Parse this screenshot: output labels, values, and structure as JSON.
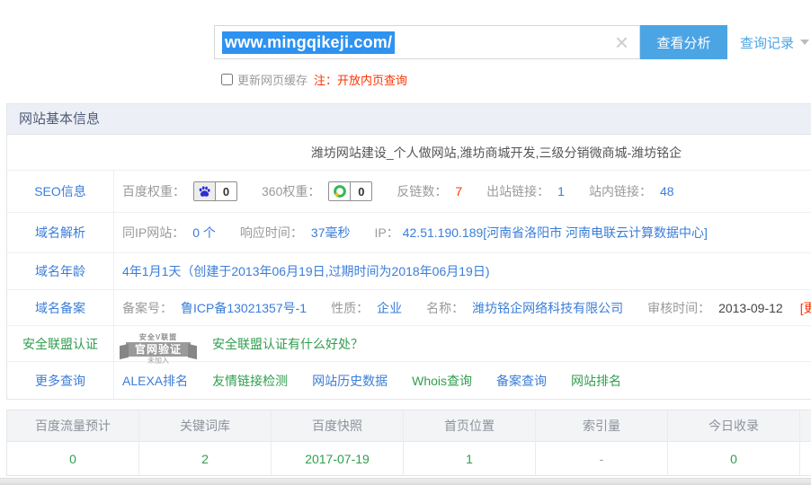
{
  "colors": {
    "link_blue": "#3b7dd8",
    "button_blue": "#4ba4e4",
    "selection_blue": "#2e92f0",
    "green": "#2f9e4e",
    "red": "#ff3300"
  },
  "search": {
    "value": "www.mingqikeji.com/",
    "analyze_button": "查看分析",
    "history_link": "查询记录",
    "cache_checkbox_label": "更新网页缓存",
    "note": "注：开放内页查询"
  },
  "panel": {
    "header": "网站基本信息",
    "site_title": "潍坊网站建设_个人做网站,潍坊商城开发,三级分销微商城-潍坊铭企"
  },
  "seo": {
    "label": "SEO信息",
    "baidu_weight_label": "百度权重：",
    "baidu_weight_value": "0",
    "so360_weight_label": "360权重：",
    "so360_weight_value": "0",
    "backlinks_label": "反链数：",
    "backlinks_value": "7",
    "outlinks_label": "出站链接：",
    "outlinks_value": "1",
    "inlinks_label": "站内链接：",
    "inlinks_value": "48"
  },
  "dns": {
    "label": "域名解析",
    "same_ip_label": "同IP网站：",
    "same_ip_value": "0 个",
    "response_label": "响应时间：",
    "response_value": "37毫秒",
    "ip_label": "IP：",
    "ip_value": "42.51.190.189[河南省洛阳市 河南电联云计算数据中心]"
  },
  "age": {
    "label": "域名年龄",
    "value": "4年1月1天（创建于2013年06月19日,过期时间为2018年06月19日)"
  },
  "icp": {
    "label": "域名备案",
    "number_label": "备案号：",
    "number_value": "鲁ICP备13021357号-1",
    "nature_label": "性质：",
    "nature_value": "企业",
    "name_label": "名称：",
    "name_value": "潍坊铭企网络科技有限公司",
    "audit_label": "审核时间：",
    "audit_value": "2013-09-12",
    "update_link": "[更新]"
  },
  "security": {
    "label": "安全联盟认证",
    "badge_top": "安全V联盟",
    "badge_mid": "官网验证",
    "badge_bottom": "未加入",
    "benefit_link": "安全联盟认证有什么好处？"
  },
  "more": {
    "label": "更多查询",
    "links": [
      {
        "label": "ALEXA排名",
        "color": "blue"
      },
      {
        "label": "友情链接检测",
        "color": "green"
      },
      {
        "label": "网站历史数据",
        "color": "blue"
      },
      {
        "label": "Whois查询",
        "color": "green"
      },
      {
        "label": "备案查询",
        "color": "blue"
      },
      {
        "label": "网站排名",
        "color": "green"
      }
    ]
  },
  "stats": {
    "headers": [
      "百度流量预计",
      "关键词库",
      "百度快照",
      "首页位置",
      "索引量",
      "今日收录"
    ],
    "values": [
      "0",
      "2",
      "2017-07-19",
      "1",
      "-",
      "0"
    ]
  }
}
